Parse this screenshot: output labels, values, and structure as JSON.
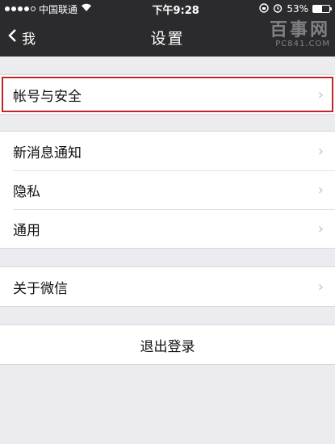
{
  "status": {
    "carrier": "中国联通",
    "time": "下午9:28",
    "battery": "53%",
    "battery_level": 0.53
  },
  "nav": {
    "back_label": "我",
    "title": "设置"
  },
  "watermark": {
    "main": "百事网",
    "sub": "PC841.COM"
  },
  "groups": [
    {
      "items": [
        "帐号与安全"
      ]
    },
    {
      "items": [
        "新消息通知",
        "隐私",
        "通用"
      ]
    },
    {
      "items": [
        "关于微信"
      ]
    }
  ],
  "logout_label": "退出登录",
  "colors": {
    "nav_bg": "#2b2b2d",
    "page_bg": "#ebebf0",
    "highlight": "#c0252c"
  }
}
